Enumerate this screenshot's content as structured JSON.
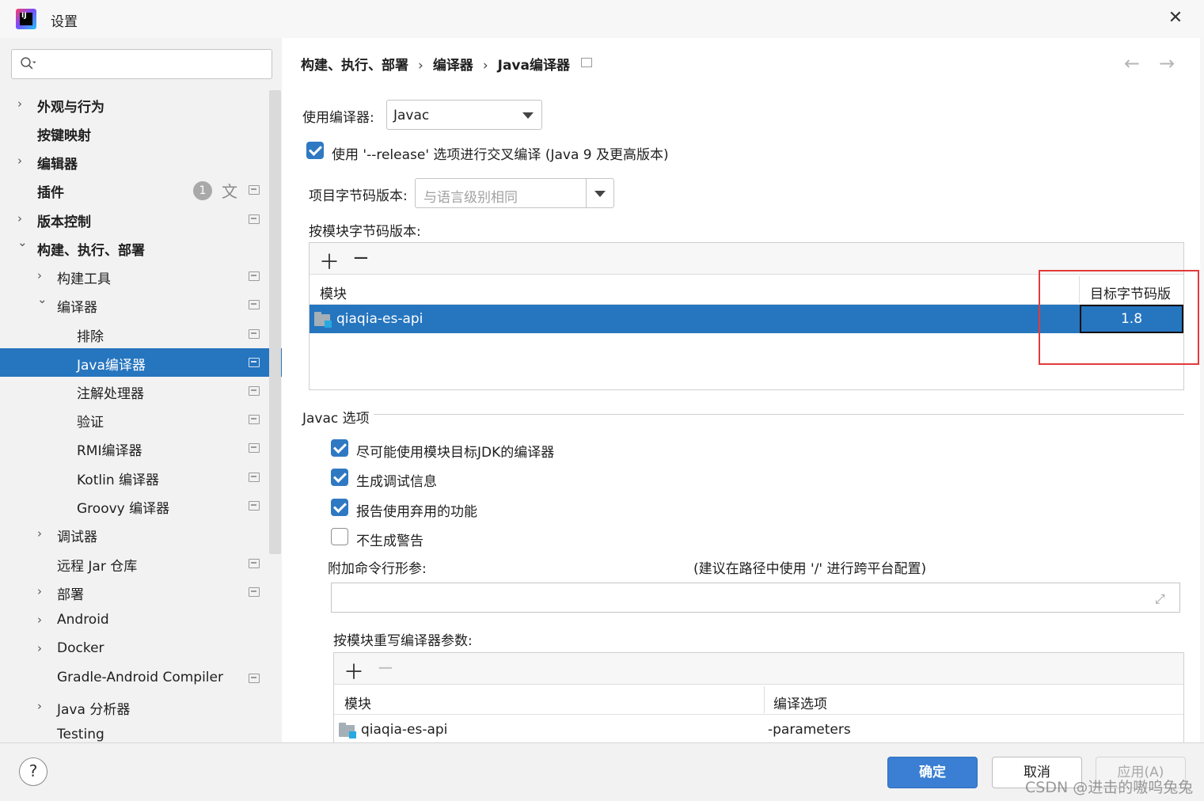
{
  "window": {
    "title": "设置"
  },
  "search": {
    "placeholder": "",
    "value": ""
  },
  "sidebar": {
    "items": [
      {
        "label": "外观与行为",
        "bold": true,
        "expandable": true,
        "expanded": false
      },
      {
        "label": "按键映射",
        "bold": true,
        "expandable": false
      },
      {
        "label": "编辑器",
        "bold": true,
        "expandable": true,
        "expanded": false
      },
      {
        "label": "插件",
        "bold": true,
        "expandable": false,
        "badge": "1"
      },
      {
        "label": "版本控制",
        "bold": true,
        "expandable": true,
        "expanded": false
      },
      {
        "label": "构建、执行、部署",
        "bold": true,
        "expandable": true,
        "expanded": true
      },
      {
        "label": "构建工具",
        "expandable": true,
        "expanded": false
      },
      {
        "label": "编译器",
        "expandable": true,
        "expanded": true
      },
      {
        "label": "排除"
      },
      {
        "label": "Java编译器",
        "selected": true
      },
      {
        "label": "注解处理器"
      },
      {
        "label": "验证"
      },
      {
        "label": "RMI编译器"
      },
      {
        "label": "Kotlin 编译器"
      },
      {
        "label": "Groovy 编译器"
      },
      {
        "label": "调试器",
        "expandable": true,
        "expanded": false
      },
      {
        "label": "远程 Jar 仓库"
      },
      {
        "label": "部署",
        "expandable": true,
        "expanded": false
      },
      {
        "label": "Android",
        "expandable": true,
        "expanded": false
      },
      {
        "label": "Docker",
        "expandable": true,
        "expanded": false
      },
      {
        "label": "Gradle-Android Compiler"
      },
      {
        "label": "Java 分析器",
        "expandable": true,
        "expanded": false
      },
      {
        "label": "Testing"
      }
    ]
  },
  "breadcrumb": {
    "items": [
      "构建、执行、部署",
      "编译器",
      "Java编译器"
    ],
    "separator": "›"
  },
  "compiler": {
    "use_label": "使用编译器:",
    "selected": "Javac",
    "release_checkbox_label": "使用 '--release' 选项进行交叉编译 (Java 9 及更高版本)",
    "release_checked": true,
    "bytecode_label": "项目字节码版本:",
    "bytecode_placeholder": "与语言级别相同",
    "per_module_label": "按模块字节码版本:"
  },
  "module_table": {
    "headers": [
      "模块",
      "目标字节码版本"
    ],
    "rows": [
      {
        "module": "qiaqia-es-api",
        "target": "1.8",
        "selected": true
      }
    ]
  },
  "javac_options": {
    "section_title": "Javac 选项",
    "checkboxes": [
      {
        "label": "尽可能使用模块目标JDK的编译器",
        "checked": true
      },
      {
        "label": "生成调试信息",
        "checked": true
      },
      {
        "label": "报告使用弃用的功能",
        "checked": true
      },
      {
        "label": "不生成警告",
        "checked": false
      }
    ],
    "args_label": "附加命令行形参:",
    "args_hint": "(建议在路径中使用 '/' 进行跨平台配置)",
    "args_value": "",
    "override_label": "按模块重写编译器参数:"
  },
  "override_table": {
    "headers": [
      "模块",
      "编译选项"
    ],
    "rows": [
      {
        "module": "qiaqia-es-api",
        "options": "-parameters"
      }
    ]
  },
  "footer": {
    "ok": "确定",
    "cancel": "取消",
    "apply": "应用(A)",
    "help": "?"
  },
  "watermark": "CSDN @进击的嗷呜兔兔",
  "colors": {
    "accent": "#2675bf",
    "highlight": "#e23a3a",
    "checkbox": "#2f79c3"
  }
}
